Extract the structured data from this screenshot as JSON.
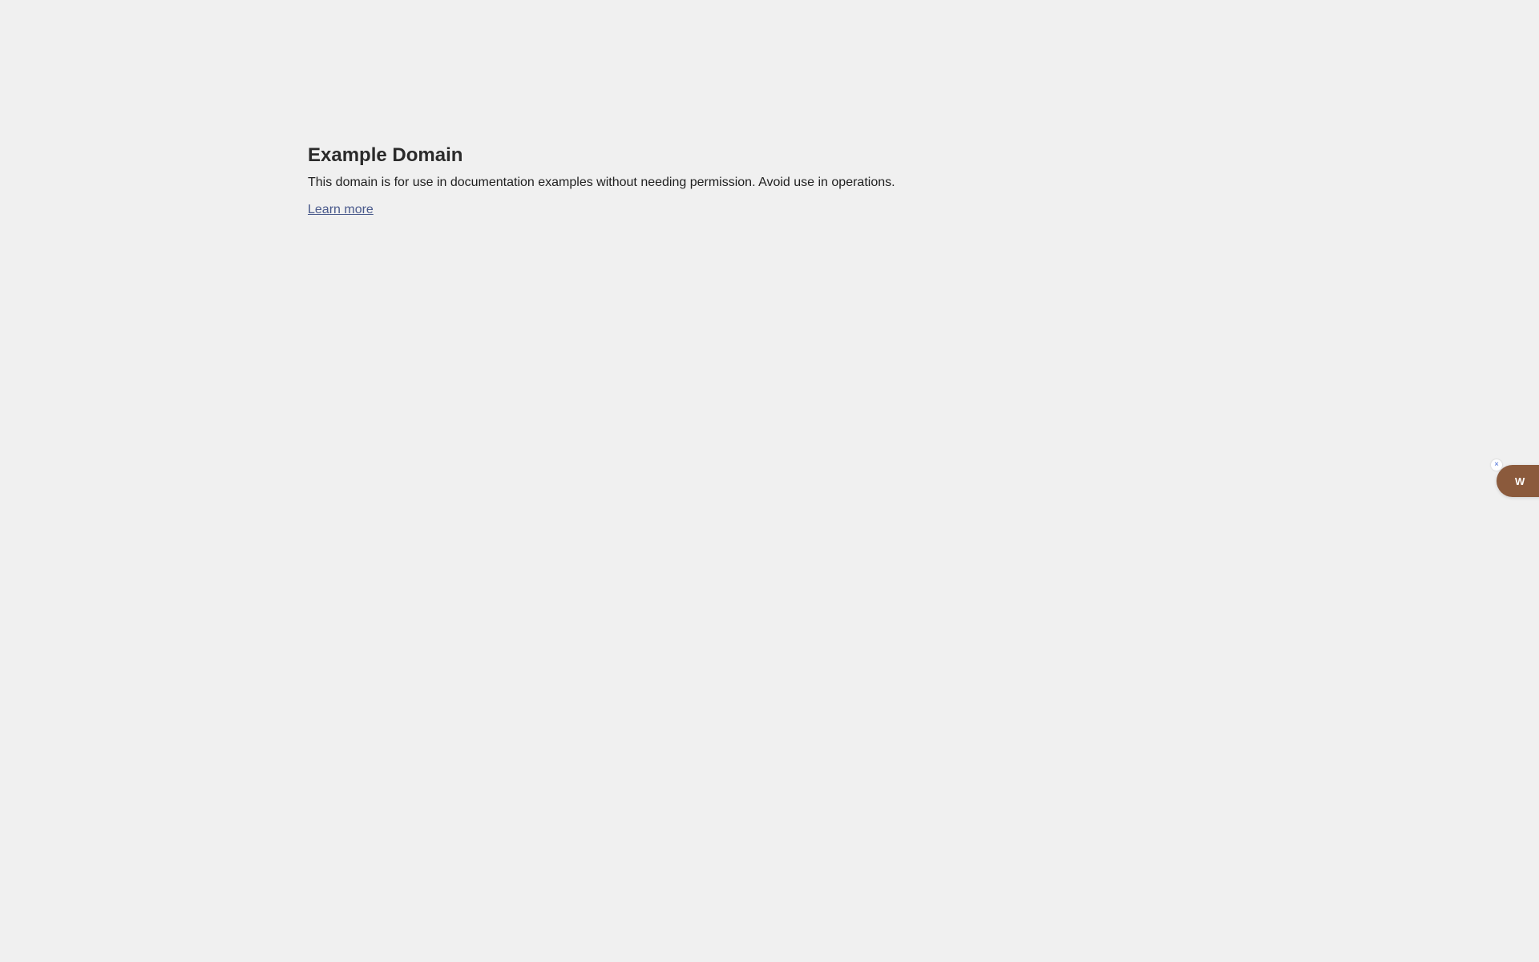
{
  "page": {
    "title": "Example Domain",
    "description": "This domain is for use in documentation examples without needing permission. Avoid use in operations.",
    "link_text": "Learn more"
  },
  "widget": {
    "label": "W",
    "close_glyph": "×",
    "close_icon": "close-icon",
    "color": "#8b5a3c"
  },
  "colors": {
    "background": "#f0f0f0",
    "link": "#4a5a8c"
  }
}
